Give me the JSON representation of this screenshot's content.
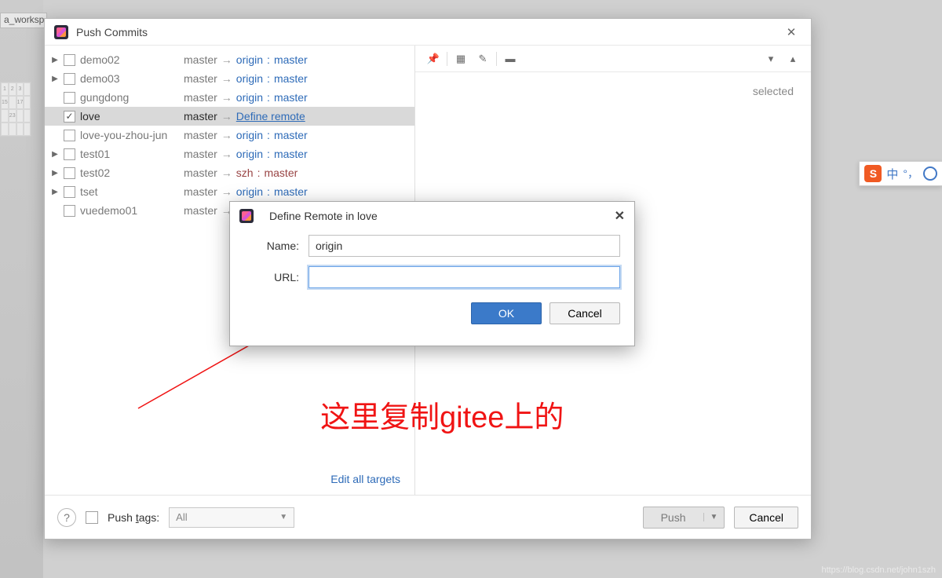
{
  "bg_tab": "a_worksp",
  "push_dialog": {
    "title": "Push Commits",
    "repos": [
      {
        "arrow": true,
        "checked": false,
        "name": "demo02",
        "local": "master",
        "remote": "origin",
        "rbranch": "master",
        "selected": false
      },
      {
        "arrow": true,
        "checked": false,
        "name": "demo03",
        "local": "master",
        "remote": "origin",
        "rbranch": "master",
        "selected": false
      },
      {
        "arrow": false,
        "checked": false,
        "name": "gungdong",
        "local": "master",
        "remote": "origin",
        "rbranch": "master",
        "selected": false
      },
      {
        "arrow": false,
        "checked": true,
        "name": "love",
        "local": "master",
        "define": "Define remote",
        "selected": true
      },
      {
        "arrow": false,
        "checked": false,
        "name": "love-you-zhou-jun",
        "local": "master",
        "remote": "origin",
        "rbranch": "master",
        "selected": false
      },
      {
        "arrow": true,
        "checked": false,
        "name": "test01",
        "local": "master",
        "remote": "origin",
        "rbranch": "master",
        "selected": false
      },
      {
        "arrow": true,
        "checked": false,
        "name": "test02",
        "local": "master",
        "remote": "szh",
        "rbranch": "master",
        "selected": false,
        "szh": true
      },
      {
        "arrow": true,
        "checked": false,
        "name": "tset",
        "local": "master",
        "remote": "origin",
        "rbranch": "master",
        "selected": false
      },
      {
        "arrow": false,
        "checked": false,
        "name": "vuedemo01",
        "local": "master",
        "remote": "",
        "rbranch": "",
        "selected": false,
        "truncated": true
      }
    ],
    "edit_targets": "Edit all targets",
    "no_commits": "selected",
    "footer": {
      "push_tags_label": "Push tags:",
      "tag_mode": "All",
      "push_btn": "Push",
      "cancel_btn": "Cancel"
    }
  },
  "define_dialog": {
    "title": "Define Remote in love",
    "name_label": "Name:",
    "name_value": "origin",
    "url_label": "URL:",
    "url_value": "",
    "ok": "OK",
    "cancel": "Cancel"
  },
  "annotation": "这里复制gitee上的",
  "ime": {
    "ch": "中",
    "punct": "°，"
  },
  "watermark": "https://blog.csdn.net/john1szh"
}
